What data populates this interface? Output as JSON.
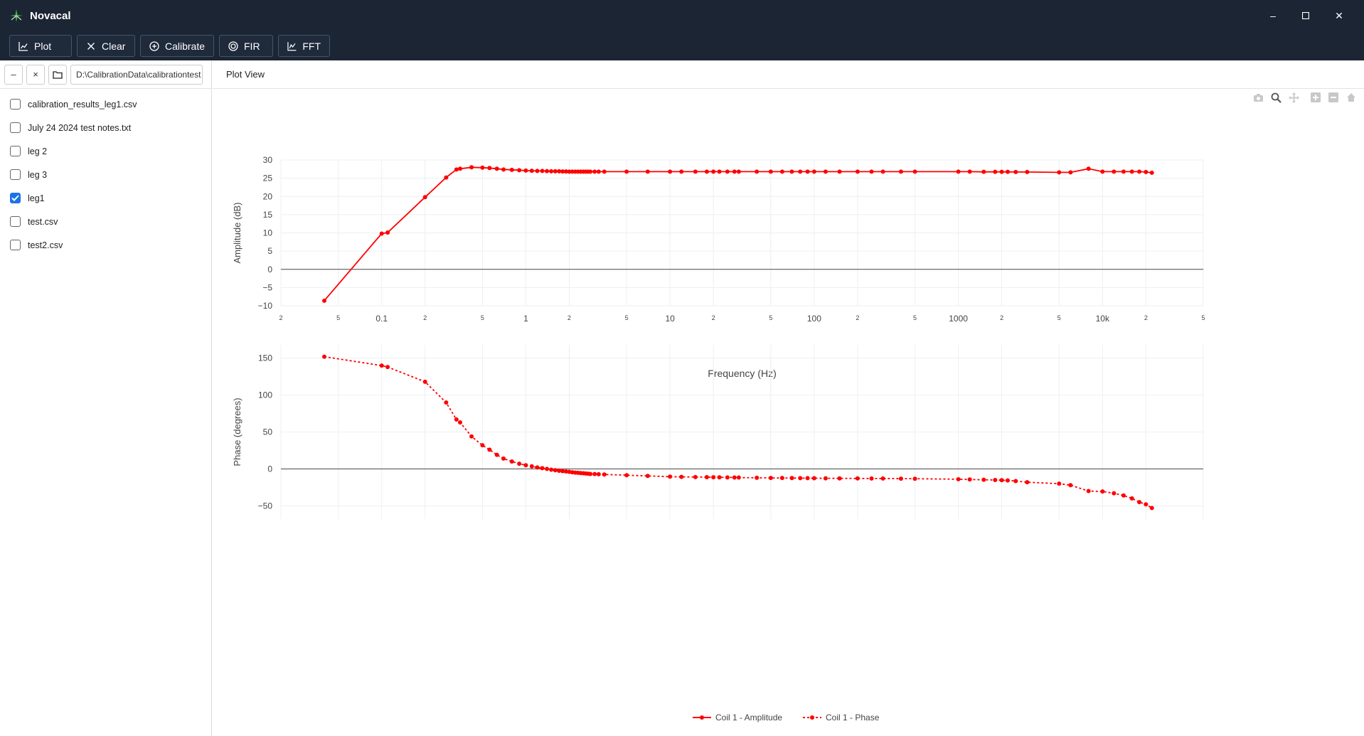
{
  "app": {
    "title": "Novacal"
  },
  "window_controls": {
    "minimize": "–",
    "maximize": "☐",
    "close": "✕"
  },
  "toolbar": {
    "buttons": [
      {
        "label": "Plot",
        "icon": "line-chart-icon"
      },
      {
        "label": "Clear",
        "icon": "close-icon"
      },
      {
        "label": "Calibrate",
        "icon": "plus-circle-icon"
      },
      {
        "label": "FIR",
        "icon": "target-icon"
      },
      {
        "label": "FFT",
        "icon": "area-chart-icon"
      }
    ]
  },
  "sidebar": {
    "collapse_label": "–",
    "clear_label": "×",
    "path": "D:\\CalibrationData\\calibrationtest",
    "files": [
      {
        "name": "calibration_results_leg1.csv",
        "checked": false
      },
      {
        "name": "July 24 2024 test notes.txt",
        "checked": false
      },
      {
        "name": "leg 2",
        "checked": false
      },
      {
        "name": "leg 3",
        "checked": false
      },
      {
        "name": "leg1",
        "checked": true
      },
      {
        "name": "test.csv",
        "checked": false
      },
      {
        "name": "test2.csv",
        "checked": false
      }
    ]
  },
  "main": {
    "header": "Plot View"
  },
  "colors": {
    "series": "#ff0000",
    "titlebar": "#1c2534",
    "checkbox": "#1a73e8"
  },
  "chart_data": [
    {
      "type": "line",
      "xscale": "log",
      "xlim": [
        0.02,
        50000
      ],
      "ylim": [
        -10,
        30
      ],
      "xlabel": "",
      "ylabel": "Amplitude (dB)",
      "yticks": [
        30,
        25,
        20,
        15,
        10,
        5,
        0,
        -5,
        -10
      ],
      "grid": true,
      "series": [
        {
          "name": "Coil 1 - Amplitude",
          "style": "solid",
          "x": [
            0.04,
            0.1,
            0.11,
            0.2,
            0.28,
            0.33,
            0.35,
            0.42,
            0.5,
            0.56,
            0.63,
            0.7,
            0.8,
            0.9,
            1.0,
            1.1,
            1.2,
            1.3,
            1.4,
            1.5,
            1.6,
            1.7,
            1.8,
            1.9,
            2.0,
            2.1,
            2.2,
            2.3,
            2.4,
            2.5,
            2.6,
            2.7,
            2.8,
            3.0,
            3.2,
            3.5,
            5,
            7,
            10,
            12,
            15,
            18,
            20,
            22,
            25,
            28,
            30,
            40,
            50,
            60,
            70,
            80,
            90,
            100,
            120,
            150,
            200,
            250,
            300,
            400,
            500,
            1000,
            1200,
            1500,
            1800,
            2000,
            2200,
            2500,
            3000,
            5000,
            6000,
            8000,
            10000,
            12000,
            14000,
            16000,
            18000,
            20000,
            22000
          ],
          "y": [
            -8.6,
            9.8,
            10.1,
            19.8,
            25.2,
            27.4,
            27.6,
            28.0,
            27.9,
            27.8,
            27.6,
            27.4,
            27.3,
            27.2,
            27.1,
            27.05,
            27.0,
            27.0,
            26.95,
            26.9,
            26.9,
            26.9,
            26.85,
            26.85,
            26.8,
            26.8,
            26.8,
            26.8,
            26.8,
            26.8,
            26.8,
            26.8,
            26.8,
            26.8,
            26.8,
            26.8,
            26.8,
            26.8,
            26.8,
            26.8,
            26.8,
            26.8,
            26.8,
            26.8,
            26.8,
            26.8,
            26.8,
            26.8,
            26.8,
            26.8,
            26.8,
            26.8,
            26.8,
            26.8,
            26.8,
            26.8,
            26.8,
            26.8,
            26.8,
            26.8,
            26.8,
            26.8,
            26.8,
            26.75,
            26.75,
            26.75,
            26.75,
            26.7,
            26.7,
            26.6,
            26.6,
            27.6,
            26.8,
            26.8,
            26.8,
            26.8,
            26.8,
            26.7,
            26.5
          ]
        }
      ]
    },
    {
      "type": "line",
      "xscale": "log",
      "xlim": [
        0.02,
        50000
      ],
      "ylim": [
        -68,
        168
      ],
      "xlabel": "Frequency (Hz)",
      "ylabel": "Phase (degrees)",
      "yticks": [
        150,
        100,
        50,
        0,
        -50
      ],
      "grid": true,
      "series": [
        {
          "name": "Coil 1 - Phase",
          "style": "dotted",
          "x": [
            0.04,
            0.1,
            0.11,
            0.2,
            0.28,
            0.33,
            0.35,
            0.42,
            0.5,
            0.56,
            0.63,
            0.7,
            0.8,
            0.9,
            1.0,
            1.1,
            1.2,
            1.3,
            1.4,
            1.5,
            1.6,
            1.7,
            1.8,
            1.9,
            2.0,
            2.1,
            2.2,
            2.3,
            2.4,
            2.5,
            2.6,
            2.7,
            2.8,
            3.0,
            3.2,
            3.5,
            5,
            7,
            10,
            12,
            15,
            18,
            20,
            22,
            25,
            28,
            30,
            40,
            50,
            60,
            70,
            80,
            90,
            100,
            120,
            150,
            200,
            250,
            300,
            400,
            500,
            1000,
            1200,
            1500,
            1800,
            2000,
            2200,
            2500,
            3000,
            5000,
            6000,
            8000,
            10000,
            12000,
            14000,
            16000,
            18000,
            20000,
            22000
          ],
          "y": [
            152,
            140,
            138,
            118,
            90,
            67,
            63,
            44,
            32,
            26,
            19,
            14,
            10,
            7,
            5,
            3.5,
            2,
            1,
            0,
            -1,
            -1.8,
            -2.5,
            -3,
            -3.5,
            -4,
            -4.5,
            -5,
            -5.3,
            -5.6,
            -5.9,
            -6.2,
            -6.5,
            -6.8,
            -7,
            -7.2,
            -7.5,
            -8.5,
            -9.5,
            -10.5,
            -10.8,
            -11,
            -11.2,
            -11.3,
            -11.4,
            -11.5,
            -11.6,
            -11.7,
            -12,
            -12.2,
            -12.3,
            -12.4,
            -12.5,
            -12.5,
            -12.6,
            -12.7,
            -12.8,
            -12.9,
            -13,
            -13,
            -13.2,
            -13.3,
            -14,
            -14.3,
            -14.7,
            -15,
            -15.3,
            -15.6,
            -16.5,
            -18,
            -20,
            -22,
            -30,
            -30.5,
            -33,
            -36,
            -40,
            -45,
            -48,
            -53
          ]
        }
      ]
    }
  ],
  "legend": {
    "placement": "bottom-center",
    "items": [
      "Coil 1 - Amplitude",
      "Coil 1 - Phase"
    ]
  },
  "modebar": {
    "icons": [
      "camera-icon",
      "zoom-icon",
      "pan-icon",
      "zoom-in-icon",
      "zoom-out-icon",
      "home-icon"
    ]
  }
}
